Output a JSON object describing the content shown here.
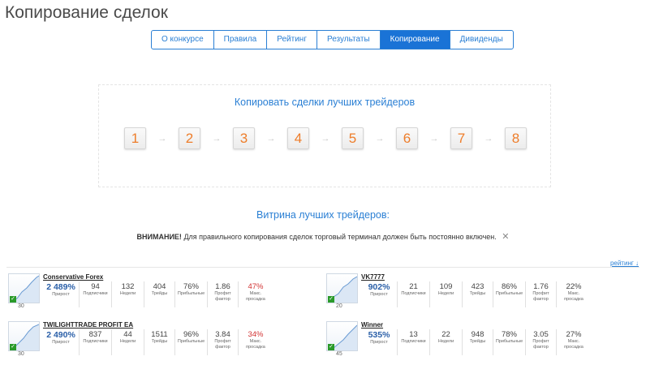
{
  "page_title": "Копирование сделок",
  "tabs": [
    {
      "label": "О конкурсе",
      "active": false
    },
    {
      "label": "Правила",
      "active": false
    },
    {
      "label": "Рейтинг",
      "active": false
    },
    {
      "label": "Результаты",
      "active": false
    },
    {
      "label": "Копирование",
      "active": true
    },
    {
      "label": "Дивиденды",
      "active": false
    }
  ],
  "steps": {
    "title": "Копировать сделки лучших трейдеров",
    "items": [
      "1",
      "2",
      "3",
      "4",
      "5",
      "6",
      "7",
      "8"
    ],
    "arrow": "→"
  },
  "showcase": {
    "title": "Витрина лучших трейдеров:",
    "warning_bold": "ВНИМАНИЕ!",
    "warning_text": " Для правильного копирования сделок торговый терминал должен быть постоянно включен.",
    "close": "✕",
    "sort_link": "рейтинг ↓"
  },
  "stat_labels": {
    "growth": "Прирост",
    "subscribers": "Подписчики",
    "weeks": "Недели",
    "trades": "Трейды",
    "profitable": "Прибыльные",
    "profit_factor_1": "Профит",
    "profit_factor_2": "фактор",
    "drawdown_1": "Макс.",
    "drawdown_2": "просадка"
  },
  "check": "✓",
  "traders": [
    {
      "name": "Conservative Forex",
      "growth": "2 489%",
      "subscribers": "94",
      "weeks": "132",
      "trades": "404",
      "profitable": "76%",
      "profit_factor": "1.86",
      "drawdown": "47%",
      "drawdown_color": "#d23333",
      "thumb_weeks": "30"
    },
    {
      "name": "VK7777",
      "growth": "902%",
      "subscribers": "21",
      "weeks": "109",
      "trades": "423",
      "profitable": "86%",
      "profit_factor": "1.76",
      "drawdown": "22%",
      "drawdown_color": "#444444",
      "thumb_weeks": "20"
    },
    {
      "name": "TWILIGHTTRADE PROFIT EA",
      "growth": "2 490%",
      "subscribers": "837",
      "weeks": "44",
      "trades": "1511",
      "profitable": "96%",
      "profit_factor": "3.84",
      "drawdown": "34%",
      "drawdown_color": "#d23333",
      "thumb_weeks": "30"
    },
    {
      "name": "Winner",
      "growth": "535%",
      "subscribers": "13",
      "weeks": "22",
      "trades": "948",
      "profitable": "78%",
      "profit_factor": "3.05",
      "drawdown": "27%",
      "drawdown_color": "#444444",
      "thumb_weeks": "45"
    }
  ]
}
